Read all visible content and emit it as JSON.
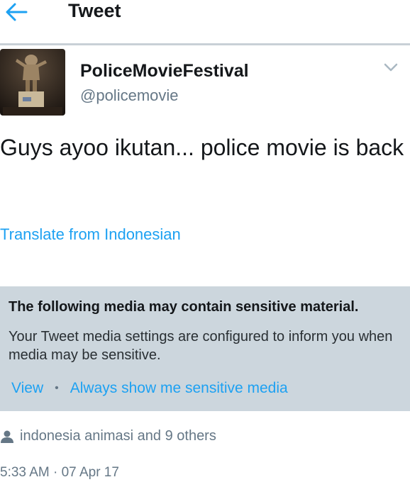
{
  "header": {
    "title": "Tweet",
    "back_icon": "arrow-left-icon",
    "accent_color": "#1da1f2"
  },
  "tweet": {
    "display_name": "PoliceMovieFestival",
    "handle": "@policemovie",
    "text": "Guys ayoo ikutan... police movie is back",
    "translate_label": "Translate from Indonesian",
    "timestamp": "5:33 AM · 07 Apr 17",
    "caret_icon": "chevron-down-icon"
  },
  "sensitive": {
    "title": "The following media may contain sensitive material.",
    "description": "Your Tweet media settings are configured to inform you when media may be sensitive.",
    "view_label": "View",
    "separator": "•",
    "always_show_label": "Always show me sensitive media"
  },
  "social": {
    "icon": "person-icon",
    "text": "indonesia animasi and 9 others"
  }
}
